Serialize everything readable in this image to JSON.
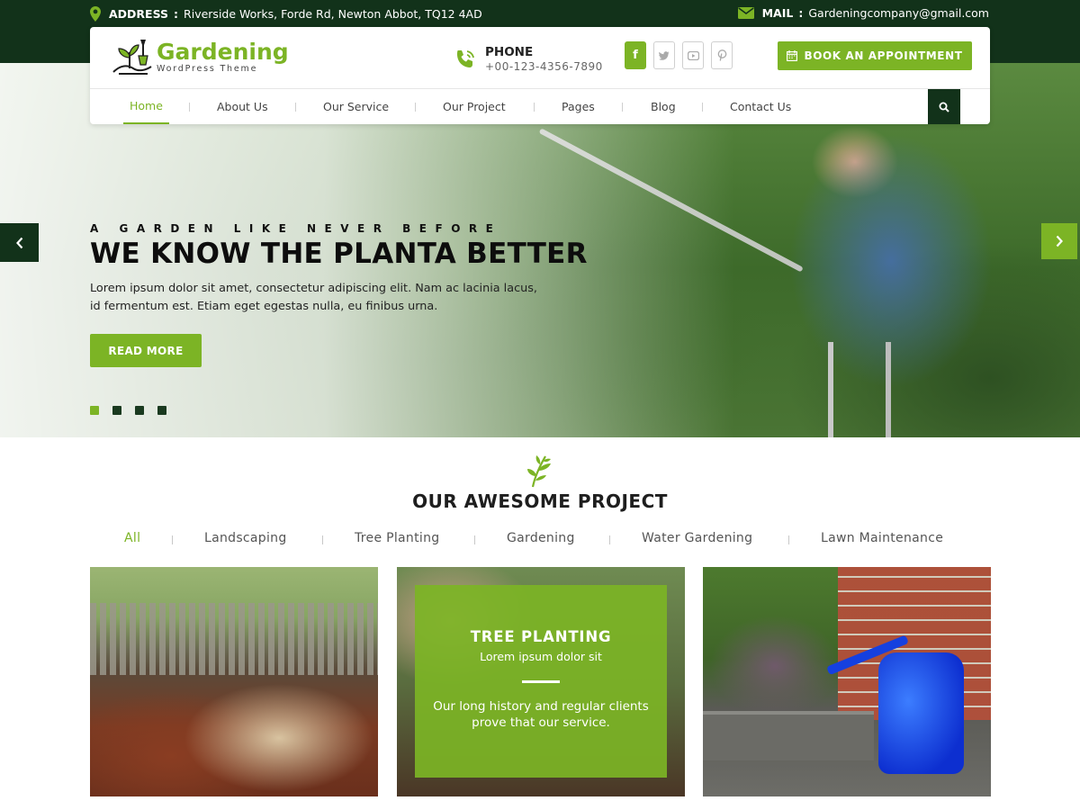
{
  "topbar": {
    "address_label": "ADDRESS",
    "address_value": "Riverside Works, Forde Rd, Newton Abbot, TQ12 4AD",
    "mail_label": "MAIL",
    "mail_value": "Gardeningcompany@gmail.com"
  },
  "header": {
    "logo_name": "Gardening",
    "logo_sub": "WordPress Theme",
    "phone_label": "PHONE",
    "phone_number": "+00-123-4356-7890",
    "socials": [
      "f",
      "twitter-icon",
      "youtube-icon",
      "pinterest-icon"
    ],
    "book_label": "BOOK AN APPOINTMENT"
  },
  "nav": {
    "items": [
      {
        "label": "Home",
        "active": true
      },
      {
        "label": "About Us"
      },
      {
        "label": "Our Service"
      },
      {
        "label": "Our Project"
      },
      {
        "label": "Pages"
      },
      {
        "label": "Blog"
      },
      {
        "label": "Contact Us"
      }
    ]
  },
  "hero": {
    "kicker": "A GARDEN LIKE NEVER BEFORE",
    "title": "WE KNOW THE PLANTA BETTER",
    "text": "Lorem ipsum dolor sit amet, consectetur adipiscing elit. Nam ac lacinia lacus, id fermentum est. Etiam eget egestas nulla, eu finibus urna.",
    "button": "READ MORE",
    "slide_count": 4,
    "active_slide": 1
  },
  "projects": {
    "title": "OUR AWESOME PROJECT",
    "filters": [
      {
        "label": "All",
        "active": true
      },
      {
        "label": "Landscaping"
      },
      {
        "label": "Tree Planting"
      },
      {
        "label": "Gardening"
      },
      {
        "label": "Water Gardening"
      },
      {
        "label": "Lawn Maintenance"
      }
    ],
    "overlay": {
      "title": "TREE PLANTING",
      "subtitle": "Lorem ipsum dolor sit",
      "text": "Our long history and regular clients prove that our service."
    }
  },
  "colors": {
    "brand_green": "#7cb425",
    "dark_green": "#12321a"
  }
}
